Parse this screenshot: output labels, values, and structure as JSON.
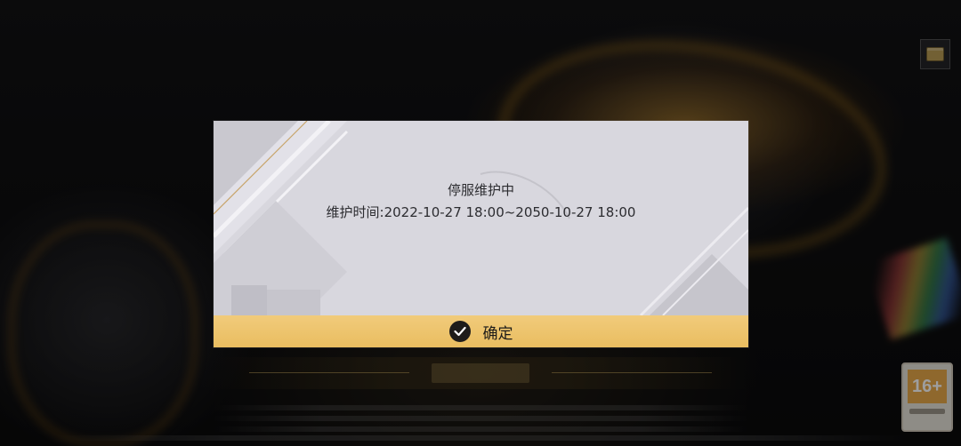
{
  "dialog": {
    "title": "停服维护中",
    "schedule": "维护时间:2022-10-27 18:00~2050-10-27 18:00",
    "confirm_label": "确定"
  },
  "badge": {
    "age_rating": "16+"
  },
  "colors": {
    "dialog_bg": "#d8d7de",
    "confirm_gold": "#ecc267",
    "age_orange": "#e7a84a",
    "background_gold": "#d6962a"
  },
  "icons": {
    "confirm": "check-circle-icon",
    "corner": "announcement-icon"
  }
}
